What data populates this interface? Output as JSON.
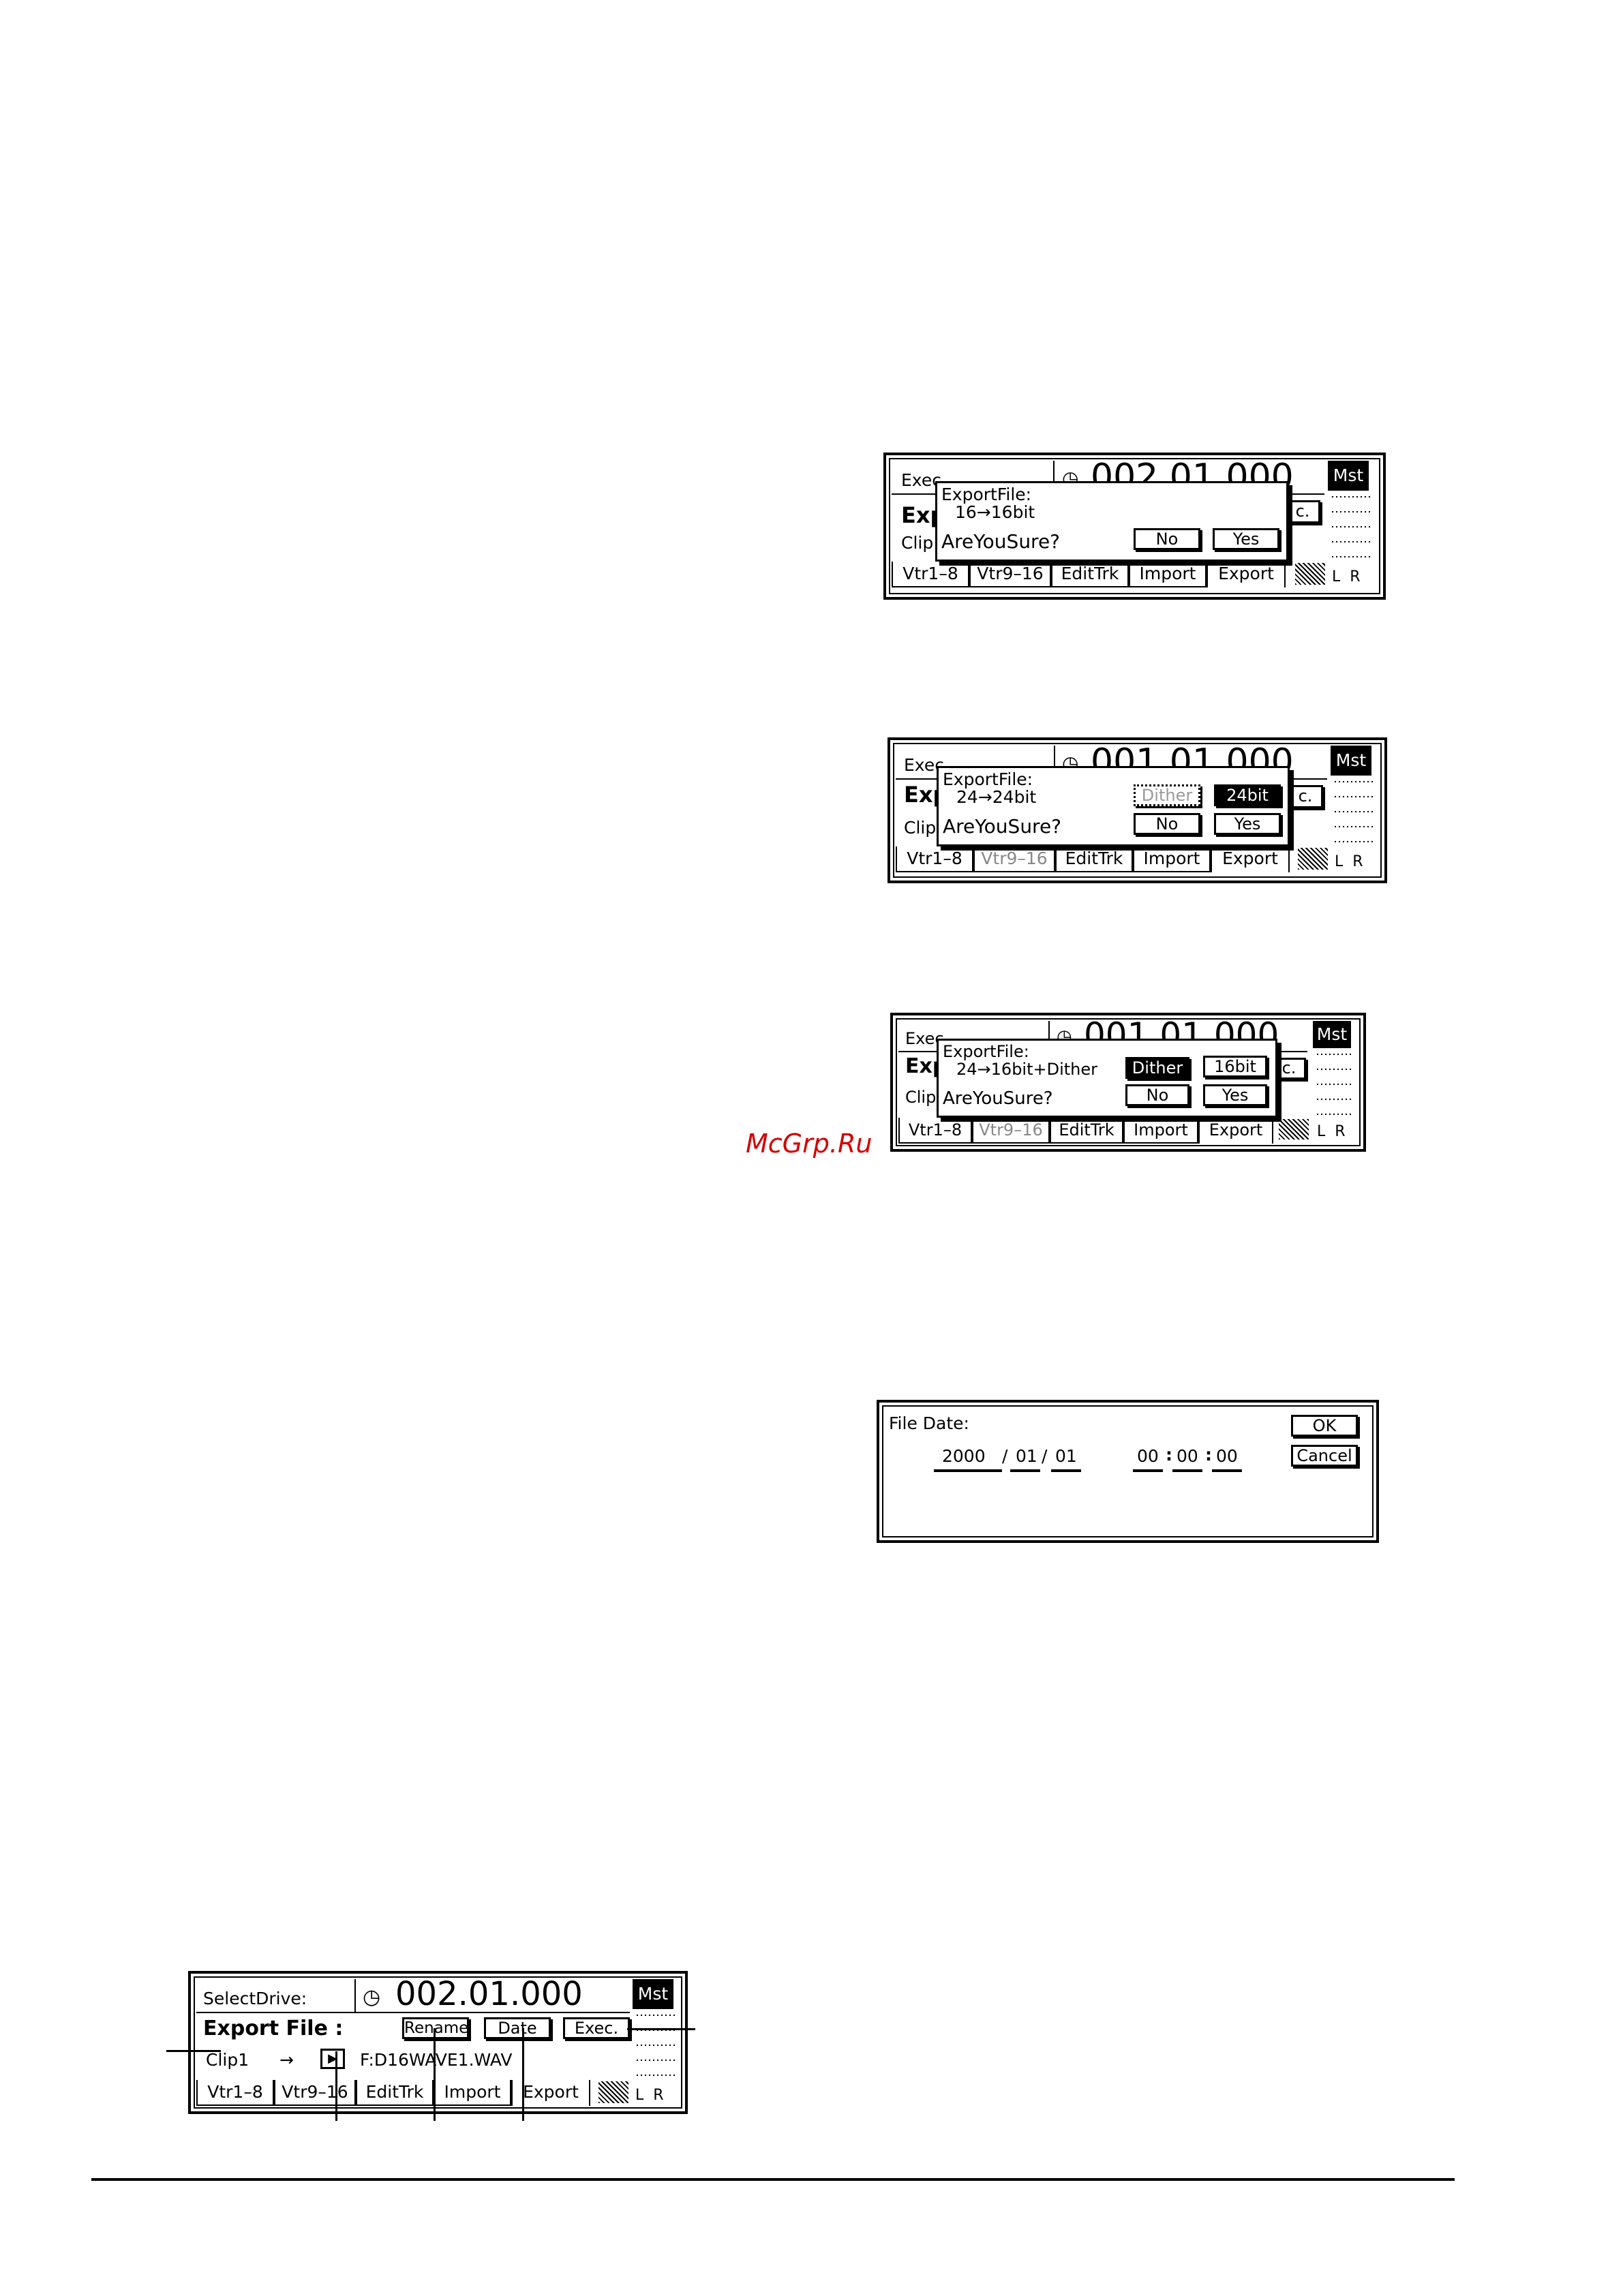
{
  "watermark": "McGrp.Ru",
  "screens": {
    "s1": {
      "header_left": "Exec",
      "header_time": "002.01.000",
      "mst": "Mst",
      "row2_left": "Exp",
      "row3_left": "Clip",
      "dialog_line1": "ExportFile:",
      "dialog_line2": "16→16bit",
      "dialog_line3": "AreYouSure?",
      "btn_no": "No",
      "btn_yes": "Yes",
      "exec_frag": "c.",
      "tabs": [
        "Vtr1–8",
        "Vtr9–16",
        "EditTrk",
        "Import",
        "Export"
      ],
      "lr": "L  R"
    },
    "s2": {
      "header_left": "Exec",
      "header_time": "001.01.000",
      "mst": "Mst",
      "row2_left": "Exp",
      "row3_left": "Clip",
      "dialog_line1": "ExportFile:",
      "dialog_line2": "24→24bit",
      "dialog_line3": "AreYouSure?",
      "btn_dither": "Dither",
      "btn_bit": "24bit",
      "btn_no": "No",
      "btn_yes": "Yes",
      "exec_frag": "c.",
      "tabs": [
        "Vtr1–8",
        "Vtr9–16",
        "EditTrk",
        "Import",
        "Export"
      ],
      "lr": "L  R"
    },
    "s3": {
      "header_left": "Exec",
      "header_time": "001.01.000",
      "mst": "Mst",
      "row2_left": "Exp",
      "row3_left": "Clip",
      "dialog_line1": "ExportFile:",
      "dialog_line2": "24→16bit+Dither",
      "dialog_line3": "AreYouSure?",
      "btn_dither": "Dither",
      "btn_bit": "16bit",
      "btn_no": "No",
      "btn_yes": "Yes",
      "exec_frag": "c.",
      "tabs": [
        "Vtr1–8",
        "Vtr9–16",
        "EditTrk",
        "Import",
        "Export"
      ],
      "lr": "L  R"
    },
    "s4": {
      "title": "File Date:",
      "year": "2000",
      "month": "01",
      "day": "01",
      "sep_date": "/",
      "hour": "00",
      "minute": "00",
      "second": "00",
      "sep_time": ":",
      "btn_ok": "OK",
      "btn_cancel": "Cancel"
    },
    "s5": {
      "header_left": "SelectDrive:",
      "header_time": "002.01.000",
      "mst": "Mst",
      "title": "Export File :",
      "btn_rename": "Rename",
      "btn_date": "Date",
      "btn_exec": "Exec.",
      "clip": "Clip1",
      "arrow": "→",
      "filename": "F:D16WAVE1.WAV",
      "tabs": [
        "Vtr1–8",
        "Vtr9–16",
        "EditTrk",
        "Import",
        "Export"
      ],
      "lr": "L  R"
    }
  }
}
